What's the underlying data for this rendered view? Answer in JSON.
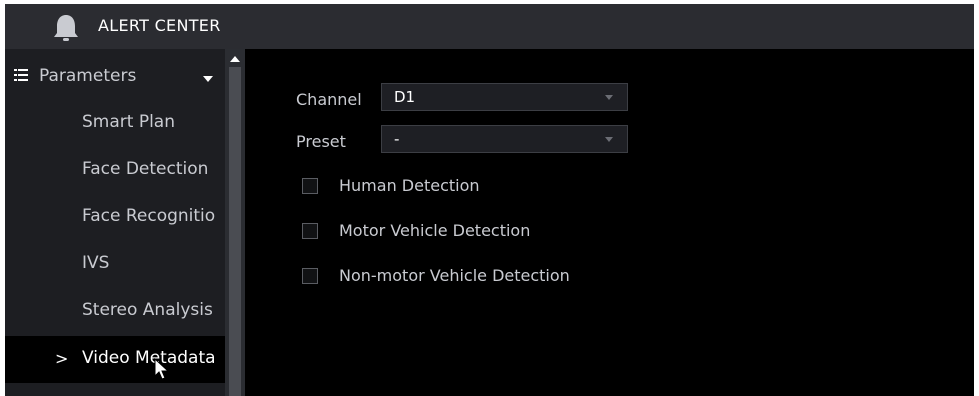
{
  "header": {
    "title": "ALERT CENTER",
    "icon": "bell-icon"
  },
  "sidebar": {
    "parent": {
      "icon": "list-icon",
      "label": "Parameters"
    },
    "items": [
      {
        "label": "Smart Plan"
      },
      {
        "label": "Face Detection"
      },
      {
        "label": "Face Recognitio"
      },
      {
        "label": "IVS"
      },
      {
        "label": "Stereo Analysis"
      },
      {
        "label": "Video Metadata",
        "active": true,
        "marker": ">"
      }
    ]
  },
  "form": {
    "channel": {
      "label": "Channel",
      "value": "D1"
    },
    "preset": {
      "label": "Preset",
      "value": "-"
    },
    "checkboxes": [
      {
        "label": "Human Detection",
        "checked": false
      },
      {
        "label": "Motor Vehicle Detection",
        "checked": false
      },
      {
        "label": "Non-motor Vehicle Detection",
        "checked": false
      }
    ]
  },
  "colors": {
    "background": "#000000",
    "sidebar": "#1d1e22",
    "titlebar": "#2b2c31",
    "text": "#c9cbd1"
  }
}
